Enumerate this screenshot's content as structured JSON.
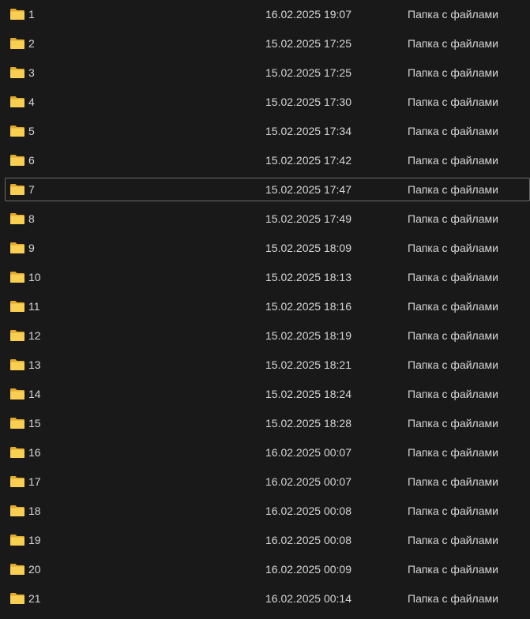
{
  "colors": {
    "background": "#191919",
    "text": "#d6d6d6",
    "focus_border": "#6b6b6b",
    "folder_back": "#e3a92a",
    "folder_front": "#f8cf52"
  },
  "icon": "folder-icon",
  "file_list": {
    "focused_index": 6,
    "rows": [
      {
        "name": "1",
        "date": "16.02.2025 19:07",
        "type": "Папка с файлами"
      },
      {
        "name": "2",
        "date": "15.02.2025 17:25",
        "type": "Папка с файлами"
      },
      {
        "name": "3",
        "date": "15.02.2025 17:25",
        "type": "Папка с файлами"
      },
      {
        "name": "4",
        "date": "15.02.2025 17:30",
        "type": "Папка с файлами"
      },
      {
        "name": "5",
        "date": "15.02.2025 17:34",
        "type": "Папка с файлами"
      },
      {
        "name": "6",
        "date": "15.02.2025 17:42",
        "type": "Папка с файлами"
      },
      {
        "name": "7",
        "date": "15.02.2025 17:47",
        "type": "Папка с файлами"
      },
      {
        "name": "8",
        "date": "15.02.2025 17:49",
        "type": "Папка с файлами"
      },
      {
        "name": "9",
        "date": "15.02.2025 18:09",
        "type": "Папка с файлами"
      },
      {
        "name": "10",
        "date": "15.02.2025 18:13",
        "type": "Папка с файлами"
      },
      {
        "name": "11",
        "date": "15.02.2025 18:16",
        "type": "Папка с файлами"
      },
      {
        "name": "12",
        "date": "15.02.2025 18:19",
        "type": "Папка с файлами"
      },
      {
        "name": "13",
        "date": "15.02.2025 18:21",
        "type": "Папка с файлами"
      },
      {
        "name": "14",
        "date": "15.02.2025 18:24",
        "type": "Папка с файлами"
      },
      {
        "name": "15",
        "date": "15.02.2025 18:28",
        "type": "Папка с файлами"
      },
      {
        "name": "16",
        "date": "16.02.2025 00:07",
        "type": "Папка с файлами"
      },
      {
        "name": "17",
        "date": "16.02.2025 00:07",
        "type": "Папка с файлами"
      },
      {
        "name": "18",
        "date": "16.02.2025 00:08",
        "type": "Папка с файлами"
      },
      {
        "name": "19",
        "date": "16.02.2025 00:08",
        "type": "Папка с файлами"
      },
      {
        "name": "20",
        "date": "16.02.2025 00:09",
        "type": "Папка с файлами"
      },
      {
        "name": "21",
        "date": "16.02.2025 00:14",
        "type": "Папка с файлами"
      }
    ]
  }
}
